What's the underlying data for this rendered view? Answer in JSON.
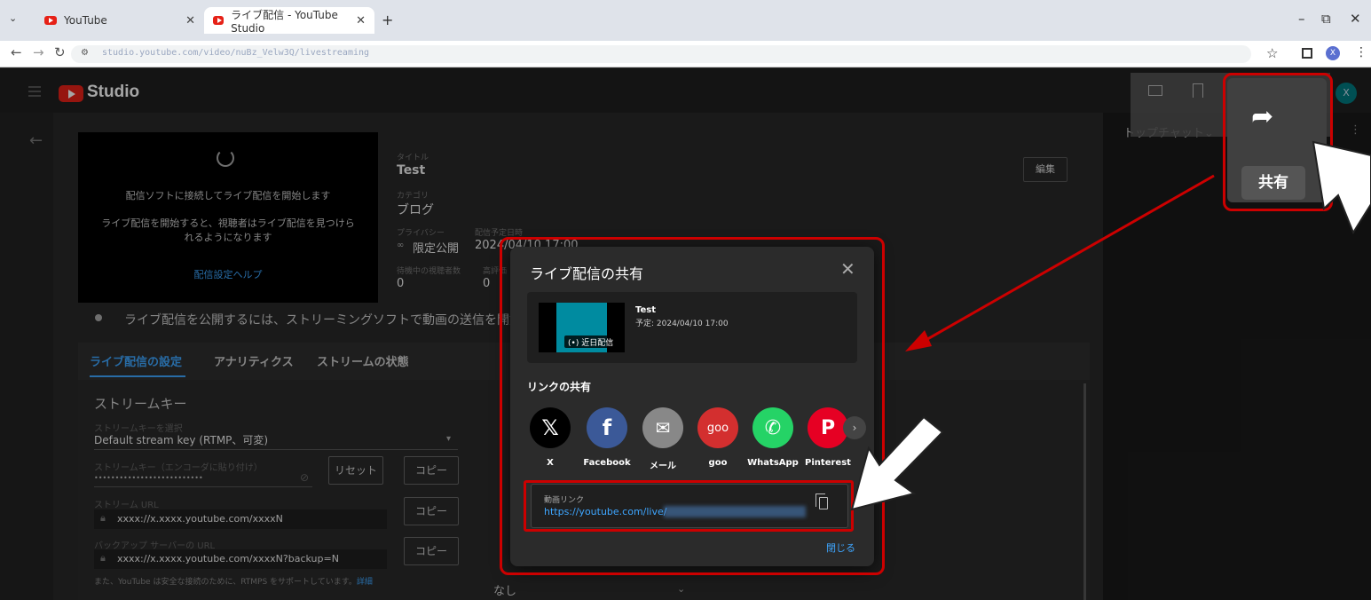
{
  "browser": {
    "tabs": [
      {
        "title": "YouTube"
      },
      {
        "title": "ライブ配信 - YouTube Studio"
      }
    ],
    "new_tab": "+",
    "url": "studio.youtube.com/video/nuBz_Velw3Q/livestreaming",
    "win_min": "–",
    "win_restore": "⧉",
    "win_close": "✕"
  },
  "studio": {
    "logo_text": "Studio",
    "avatar_letter": "X",
    "share_label": "共有",
    "top_chat": "トップチャット",
    "preview": {
      "line1": "配信ソフトに接続してライブ配信を開始します",
      "line2": "ライブ配信を開始すると、視聴者はライブ配信を見つけら",
      "line3": "れるようになります",
      "help_link": "配信設定ヘルプ"
    },
    "info": {
      "title_label": "タイトル",
      "title_value": "Test",
      "category_label": "カテゴリ",
      "category_value": "ブログ",
      "privacy_label": "プライバシー",
      "privacy_value": "限定公開",
      "scheduled_label": "配信予定日時",
      "scheduled_value": "2024/04/10 17:00",
      "waiting_label": "待機中の視聴者数",
      "waiting_value": "0",
      "likes_label": "高評価",
      "likes_value": "0",
      "edit_button": "編集"
    },
    "notice": "ライブ配信を公開するには、ストリーミングソフトで動画の送信を開始しま",
    "page_tabs": [
      "ライブ配信の設定",
      "アナリティクス",
      "ストリームの状態"
    ],
    "settings": {
      "section_title": "ストリームキー",
      "select_label": "ストリームキーを選択",
      "select_value": "Default stream key (RTMP、可変)",
      "key_label": "ストリームキー（エンコーダに貼り付け）",
      "key_value": "••••••••••••••••••••••••••",
      "reset_button": "リセット",
      "copy_button": "コピー",
      "url_label": "ストリーム URL",
      "url_value": "xxxx://x.xxxx.youtube.com/xxxxN",
      "backup_label": "バックアップ サーバーの URL",
      "backup_value": "xxxx://x.xxxx.youtube.com/xxxxN?backup=N",
      "rtmps_note": "また、YouTube は安全な接続のために、RTMPS をサポートしています。",
      "rtmps_link": "詳細",
      "right_none": "なし"
    }
  },
  "modal": {
    "title": "ライブ配信の共有",
    "video_title": "Test",
    "video_schedule": "予定: 2024/04/10 17:00",
    "thumb_badge": "(•) 近日配信",
    "share_section": "リンクの共有",
    "share_options": [
      {
        "label": "X",
        "glyph": "𝕏",
        "color": "#000000"
      },
      {
        "label": "Facebook",
        "glyph": "f",
        "color": "#3b5998"
      },
      {
        "label": "メール",
        "glyph": "✉",
        "color": "#888888"
      },
      {
        "label": "goo",
        "glyph": "goo",
        "color": "#d32f2f"
      },
      {
        "label": "WhatsApp",
        "glyph": "✆",
        "color": "#25d366"
      },
      {
        "label": "Pinterest",
        "glyph": "P",
        "color": "#e60023"
      }
    ],
    "link_label": "動画リンク",
    "link_url": "https://youtube.com/live/",
    "close_label": "閉じる"
  },
  "colors": {
    "accent": "#3ea6ff",
    "annotation_red": "#cc0000"
  }
}
